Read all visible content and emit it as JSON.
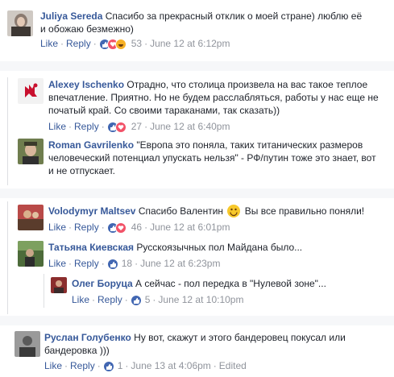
{
  "actions": {
    "like": "Like",
    "reply": "Reply",
    "dot": "·"
  },
  "comments": [
    {
      "name": "Juliya Sereda",
      "text": "Спасибо за прекрасный отклик о моей стране) люблю её и обожаю безмежно)",
      "count": "53",
      "time": "June 12 at 6:12pm"
    },
    {
      "name": "Alexey Ischenko",
      "text": "Отрадно, что столица произвела на вас такое теплое впечатление. Приятно. Но не будем расслабляться, работы у нас еще не початый край. Со своими тараканами, так сказать))",
      "count": "27",
      "time": "June 12 at 6:40pm"
    },
    {
      "name": "Roman Gavrilenko",
      "text": "\"Европа это поняла, таких титанических размеров человеческий потенциал упускать нельзя\" - РФ/путин тоже это знает, вот и не отпускает."
    },
    {
      "name": "Volodymyr Maltsev",
      "text": "Спасибо Валентин",
      "text2": "Вы все правильно поняли!",
      "count": "46",
      "time": "June 12 at 6:01pm"
    },
    {
      "name": "Татьяна Киевская",
      "text": "Русскоязычных пол Майдана было...",
      "count": "18",
      "time": "June 12 at 6:23pm"
    },
    {
      "name": "Олег Боруца",
      "text": "А сейчас - пол передка в \"Нулевой зоне\"...",
      "count": "5",
      "time": "June 12 at 10:10pm"
    },
    {
      "name": "Руслан Голубенко",
      "text": "Ну вот, скажут и этого бандеровец покусал или бандеровка )))",
      "count": "1",
      "time": "June 13 at 4:06pm",
      "edited": "Edited"
    }
  ],
  "colors": {
    "link": "#365899",
    "meta": "#90949c",
    "like": "#4267b2",
    "love": "#f25268",
    "haha": "#f7b125"
  },
  "icons": [
    "like-reaction-icon",
    "love-reaction-icon",
    "haha-reaction-icon",
    "smiley-emoji-icon"
  ]
}
